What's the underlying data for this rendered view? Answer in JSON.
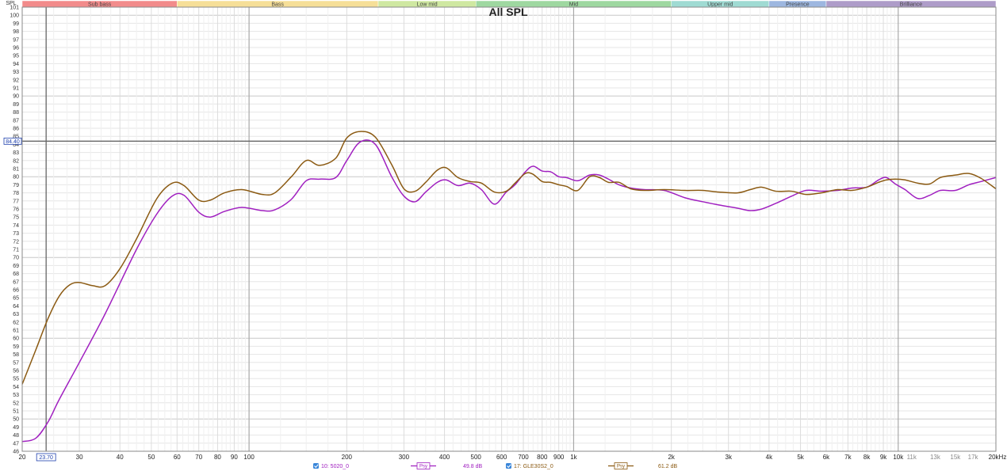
{
  "chart_data": {
    "type": "line",
    "title": "All SPL",
    "ylabel": "SPL",
    "xunit_label": "20kHz",
    "xscale": "log",
    "xlim": [
      20,
      20000
    ],
    "ylim": [
      46,
      101
    ],
    "grid": true,
    "bands": [
      {
        "name": "Sub bass",
        "from": 20,
        "to": 60,
        "color": "#f28b8b"
      },
      {
        "name": "Bass",
        "from": 60,
        "to": 250,
        "color": "#f6df98"
      },
      {
        "name": "Low mid",
        "from": 250,
        "to": 500,
        "color": "#cfe8a1"
      },
      {
        "name": "Mid",
        "from": 500,
        "to": 2000,
        "color": "#9ed8a0"
      },
      {
        "name": "Upper mid",
        "from": 2000,
        "to": 4000,
        "color": "#9fdbd3"
      },
      {
        "name": "Presence",
        "from": 4000,
        "to": 6000,
        "color": "#9db7e0"
      },
      {
        "name": "Brilliance",
        "from": 6000,
        "to": 20000,
        "color": "#ae9cc9"
      }
    ],
    "x_ticks": [
      {
        "v": 20,
        "t": "20"
      },
      {
        "v": 30,
        "t": "30"
      },
      {
        "v": 40,
        "t": "40"
      },
      {
        "v": 50,
        "t": "50"
      },
      {
        "v": 60,
        "t": "60"
      },
      {
        "v": 70,
        "t": "70"
      },
      {
        "v": 80,
        "t": "80"
      },
      {
        "v": 90,
        "t": "90"
      },
      {
        "v": 100,
        "t": "100"
      },
      {
        "v": 200,
        "t": "200"
      },
      {
        "v": 300,
        "t": "300"
      },
      {
        "v": 400,
        "t": "400"
      },
      {
        "v": 500,
        "t": "500"
      },
      {
        "v": 600,
        "t": "600"
      },
      {
        "v": 700,
        "t": "700"
      },
      {
        "v": 800,
        "t": "800"
      },
      {
        "v": 900,
        "t": "900"
      },
      {
        "v": 1000,
        "t": "1k"
      },
      {
        "v": 2000,
        "t": "2k"
      },
      {
        "v": 3000,
        "t": "3k"
      },
      {
        "v": 4000,
        "t": "4k"
      },
      {
        "v": 5000,
        "t": "5k"
      },
      {
        "v": 6000,
        "t": "6k"
      },
      {
        "v": 7000,
        "t": "7k"
      },
      {
        "v": 8000,
        "t": "8k"
      },
      {
        "v": 9000,
        "t": "9k"
      },
      {
        "v": 10000,
        "t": "10k"
      },
      {
        "v": 11000,
        "t": "11k",
        "minor": true
      },
      {
        "v": 13000,
        "t": "13k",
        "minor": true
      },
      {
        "v": 15000,
        "t": "15k",
        "minor": true
      },
      {
        "v": 17000,
        "t": "17k",
        "minor": true
      }
    ],
    "cursor": {
      "x": 23.7,
      "x_label": "23.70",
      "y": 84.4,
      "y_label": "84.40"
    },
    "series": [
      {
        "name": "10: 5020_0",
        "color": "#a020c0",
        "offset_label": "49.8 dB",
        "smoothing_label": "Psy",
        "x": [
          20,
          22,
          24,
          26,
          30,
          36,
          45,
          52,
          58,
          63,
          70,
          76,
          84,
          95,
          110,
          120,
          135,
          150,
          165,
          185,
          200,
          220,
          245,
          275,
          300,
          325,
          350,
          380,
          405,
          440,
          480,
          520,
          570,
          620,
          660,
          710,
          750,
          800,
          850,
          900,
          950,
          1030,
          1120,
          1200,
          1280,
          1380,
          1500,
          1650,
          1900,
          2200,
          2500,
          2800,
          3200,
          3500,
          3800,
          4200,
          4700,
          5200,
          5800,
          6500,
          7200,
          8000,
          8700,
          9200,
          9800,
          10500,
          11500,
          12500,
          13500,
          15000,
          16500,
          18000,
          20000
        ],
        "y": [
          47.2,
          47.6,
          49.6,
          52.4,
          57.0,
          63.0,
          71.0,
          75.4,
          77.6,
          77.7,
          75.6,
          75.0,
          75.7,
          76.2,
          75.8,
          75.9,
          77.2,
          79.5,
          79.7,
          79.9,
          82.0,
          84.3,
          84.0,
          80.0,
          77.6,
          76.9,
          78.1,
          79.3,
          79.6,
          78.9,
          79.2,
          78.4,
          76.6,
          78.1,
          79.0,
          80.6,
          81.3,
          80.7,
          80.6,
          80.0,
          79.9,
          79.5,
          80.2,
          80.2,
          79.7,
          79.0,
          78.6,
          78.4,
          78.3,
          77.4,
          76.9,
          76.5,
          76.1,
          75.8,
          76.0,
          76.7,
          77.6,
          78.3,
          78.2,
          78.3,
          78.6,
          78.7,
          79.6,
          79.9,
          79.1,
          78.4,
          77.3,
          77.7,
          78.3,
          78.3,
          79.0,
          79.4,
          79.9
        ]
      },
      {
        "name": "17: GLE30S2_0",
        "color": "#8b5a12",
        "offset_label": "61.2 dB",
        "smoothing_label": "Psy",
        "x": [
          20,
          22,
          24,
          26,
          28,
          30,
          33,
          36,
          40,
          45,
          52,
          58,
          63,
          70,
          76,
          84,
          95,
          110,
          120,
          135,
          150,
          165,
          185,
          200,
          220,
          245,
          275,
          300,
          325,
          350,
          380,
          405,
          440,
          480,
          520,
          570,
          620,
          660,
          710,
          750,
          800,
          850,
          900,
          950,
          1030,
          1120,
          1200,
          1280,
          1380,
          1500,
          1650,
          1900,
          2200,
          2500,
          2800,
          3200,
          3500,
          3800,
          4200,
          4700,
          5200,
          5800,
          6500,
          7200,
          8000,
          8700,
          9200,
          9800,
          10500,
          11500,
          12500,
          13500,
          15000,
          16500,
          18000,
          20000
        ],
        "y": [
          54.3,
          58.5,
          62.4,
          65.2,
          66.6,
          66.9,
          66.5,
          66.5,
          68.6,
          72.3,
          77.3,
          79.2,
          78.9,
          77.1,
          77.1,
          78.0,
          78.4,
          77.8,
          78.0,
          80.0,
          82.0,
          81.4,
          82.3,
          84.8,
          85.6,
          84.9,
          81.5,
          78.5,
          78.2,
          79.3,
          80.8,
          81.1,
          79.9,
          79.4,
          79.2,
          78.1,
          78.2,
          79.2,
          80.4,
          80.3,
          79.4,
          79.3,
          79.0,
          78.8,
          78.3,
          80.0,
          79.9,
          79.3,
          79.3,
          78.5,
          78.3,
          78.4,
          78.3,
          78.3,
          78.1,
          78.0,
          78.4,
          78.7,
          78.2,
          78.2,
          77.8,
          78.0,
          78.4,
          78.3,
          78.7,
          79.3,
          79.6,
          79.7,
          79.6,
          79.2,
          79.1,
          79.9,
          80.2,
          80.4,
          79.8,
          78.5
        ]
      }
    ]
  }
}
